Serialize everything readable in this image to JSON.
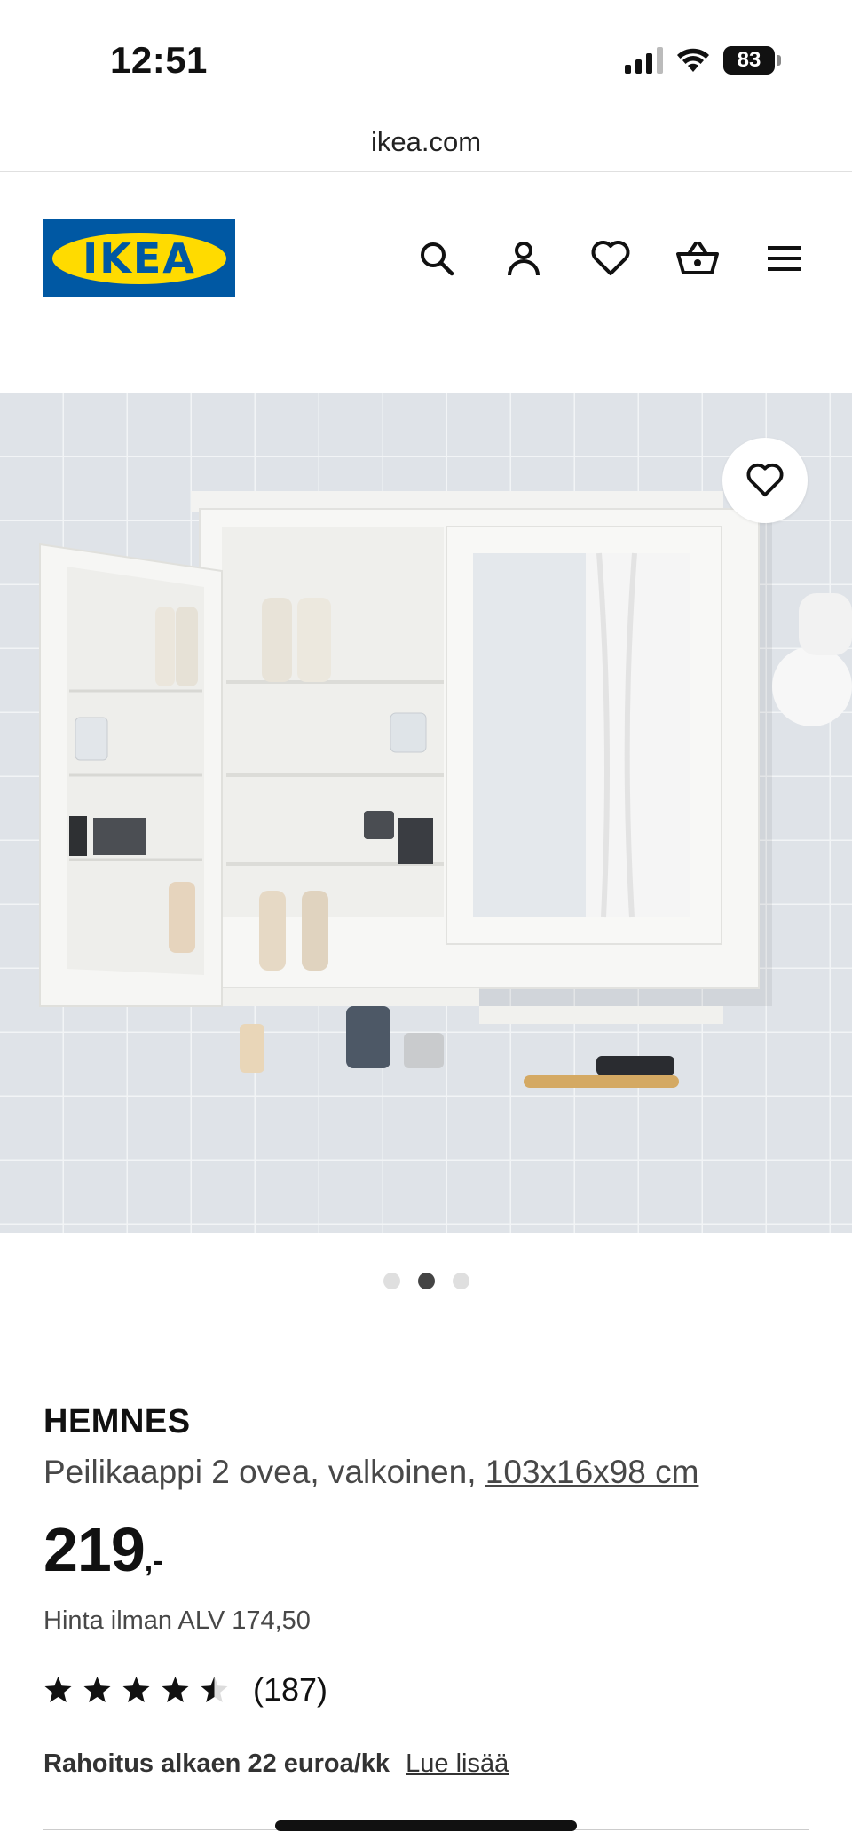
{
  "status_bar": {
    "time": "12:51",
    "battery": "83"
  },
  "browser": {
    "url": "ikea.com"
  },
  "header": {
    "logo_text": "IKEA",
    "icons": [
      "search-icon",
      "account-icon",
      "heart-icon",
      "cart-icon",
      "menu-icon"
    ]
  },
  "carousel": {
    "slide_count": 3,
    "active_index": 1
  },
  "product": {
    "brand": "HEMNES",
    "description": "Peilikaappi 2 ovea, valkoinen,",
    "dimensions": "103x16x98 cm",
    "price_integer": "219",
    "price_suffix": ",-",
    "vat_text": "Hinta ilman ALV 174,50",
    "rating_value": 4.5,
    "rating_count": "(187)",
    "finance_text": "Rahoitus alkaen 22 euroa/kk",
    "finance_link": "Lue lisää"
  },
  "colors": {
    "ikea_blue": "#0058a3",
    "ikea_yellow": "#ffdb00",
    "active_dot": "#444444"
  }
}
